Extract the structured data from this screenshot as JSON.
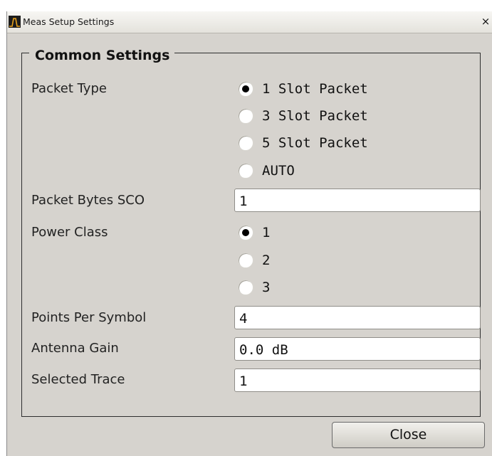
{
  "window": {
    "title": "Meas Setup Settings",
    "close_glyph": "×",
    "app_icon": "spectrum-icon"
  },
  "group": {
    "title": "Common Settings"
  },
  "packet_type": {
    "label": "Packet Type",
    "options": [
      "1 Slot Packet",
      "3 Slot Packet",
      "5 Slot Packet",
      "AUTO"
    ],
    "selected": "1 Slot Packet"
  },
  "packet_bytes_sco": {
    "label": "Packet Bytes SCO",
    "value": "1"
  },
  "power_class": {
    "label": "Power Class",
    "options": [
      "1",
      "2",
      "3"
    ],
    "selected": "1"
  },
  "points_per_symbol": {
    "label": "Points Per Symbol",
    "value": "4"
  },
  "antenna_gain": {
    "label": "Antenna Gain",
    "value": "0.0 dB"
  },
  "selected_trace": {
    "label": "Selected Trace",
    "value": "1"
  },
  "buttons": {
    "close_label": "Close"
  }
}
